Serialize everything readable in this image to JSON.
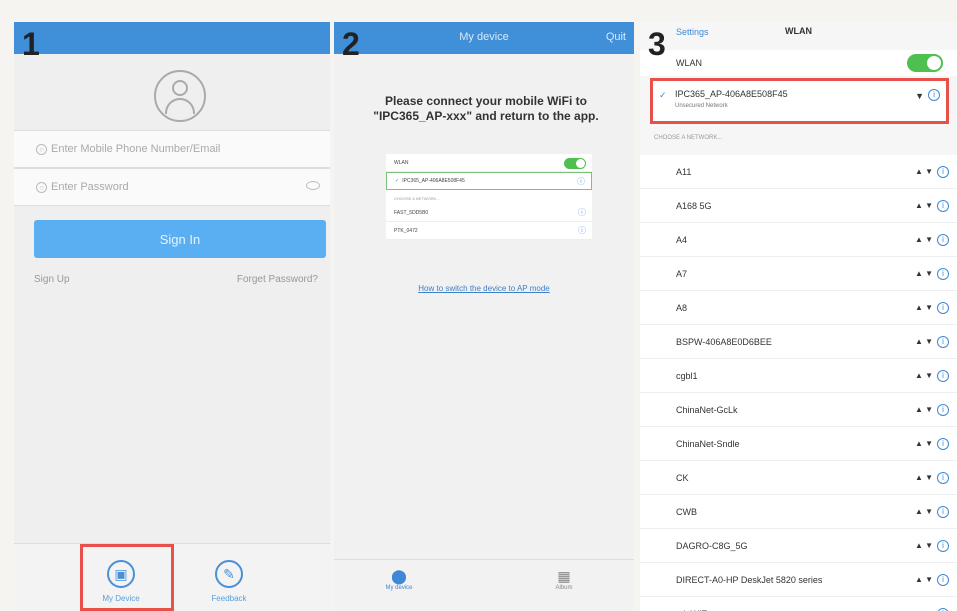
{
  "steps": [
    "1",
    "2",
    "3"
  ],
  "login": {
    "phone_placeholder": "Enter Mobile Phone Number/Email",
    "password_placeholder": "Enter Password",
    "sign_in": "Sign In",
    "sign_up": "Sign Up",
    "forgot": "Forget Password?",
    "tabs": [
      "My Device",
      "Feedback"
    ]
  },
  "connect": {
    "nav_title": "My device",
    "nav_right": "Quit",
    "instruction": "Please connect your mobile WiFi to \"IPC365_AP-xxx\" and return to the app.",
    "mini_wlan": "WLAN",
    "mini_selected": "IPC365_AP-406A8E508F45",
    "mini_choose": "CHOOSE A NETWORK...",
    "mini_nets": [
      "FAST_5DD5B0",
      "PTK_0472"
    ],
    "howto": "How to switch the device to AP mode",
    "tabs": [
      "My device",
      "Album"
    ]
  },
  "wlan": {
    "back": "Settings",
    "title": "WLAN",
    "toggle_label": "WLAN",
    "connected_name": "IPC365_AP-406A8E508F45",
    "connected_sub": "Unsecured Network",
    "choose": "CHOOSE A NETWORK...",
    "networks": [
      "A11",
      "A168 5G",
      "A4",
      "A7",
      "A8",
      "BSPW-406A8E0D6BEE",
      "cgbl1",
      "ChinaNet-GcLk",
      "ChinaNet-Sndle",
      "CK",
      "CWB",
      "DAGRO-C8G_5G",
      "DIRECT-A0-HP DeskJet 5820 series",
      "cdoWIT"
    ]
  },
  "icons": {
    "signal": "▲ ▼",
    "info": "i",
    "check": "✓"
  }
}
